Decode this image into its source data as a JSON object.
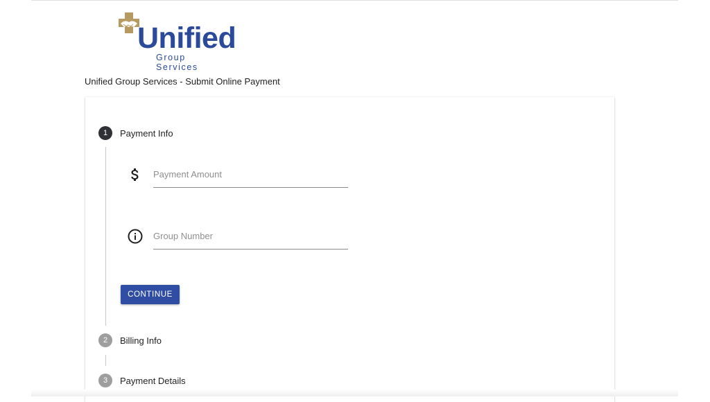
{
  "header": {
    "logo_name": "Unified",
    "logo_tagline": "Group Services",
    "page_title": "Unified Group Services - Submit Online Payment"
  },
  "stepper": {
    "steps": [
      {
        "number": "1",
        "label": "Payment Info",
        "state": "active"
      },
      {
        "number": "2",
        "label": "Billing Info",
        "state": "inactive"
      },
      {
        "number": "3",
        "label": "Payment Details",
        "state": "inactive"
      }
    ]
  },
  "payment_info": {
    "amount_placeholder": "Payment Amount",
    "amount_icon": "dollar-icon",
    "group_placeholder": "Group Number",
    "group_icon": "info-icon",
    "continue_label": "CONTINUE"
  },
  "colors": {
    "brand_blue": "#2b4a9a",
    "button_blue": "#2f4ea3",
    "logo_gold": "#b79a62",
    "active_step": "#2f3136",
    "inactive_step": "#9e9e9e"
  }
}
